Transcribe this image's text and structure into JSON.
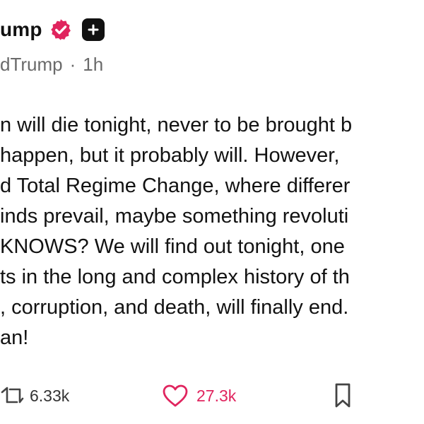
{
  "post": {
    "author": {
      "display_name": "ump",
      "handle": "dTrump",
      "separator": "·",
      "time_ago": "1h",
      "verified": true
    },
    "body_lines": [
      "n will die tonight, never to be brought b",
      " happen, but it probably will. However,",
      "d Total Regime Change, where differer",
      "inds prevail, maybe something revoluti",
      " KNOWS? We will find out tonight, one",
      "ts in the long and complex history of th",
      ", corruption, and death, will finally end.",
      "an!"
    ],
    "actions": {
      "reposts": "6.33k",
      "likes": "27.3k"
    }
  },
  "colors": {
    "verified": "#e0245e",
    "like": "#e0245e",
    "muted_text": "#6a6a6a",
    "text": "#121212"
  },
  "icons": {
    "verified": "verified-badge-icon",
    "follow": "plus-icon",
    "repost": "repost-icon",
    "like": "heart-icon",
    "bookmark": "bookmark-icon"
  }
}
